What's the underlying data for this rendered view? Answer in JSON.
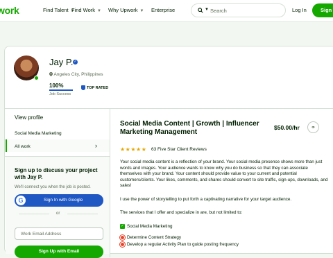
{
  "nav": {
    "logo": "work",
    "links": [
      "Find Talent",
      "Find Work",
      "Why Upwork",
      "Enterprise"
    ],
    "search_placeholder": "Search",
    "login": "Log In",
    "signup": "Sign"
  },
  "profile": {
    "name": "Jay P.",
    "location": "Angeles City, Philippines",
    "jss_value": "100%",
    "jss_fraction": 1.0,
    "jss_label": "Job Success",
    "badge": "TOP RATED"
  },
  "sidebar": {
    "view_profile": "View profile",
    "items": [
      "Social Media Marketing",
      "All work"
    ],
    "cta_title": "Sign up to discuss your project with Jay P.",
    "cta_sub": "We'll connect you when the job is posted.",
    "google_label": "Sign In with Google",
    "or": "or",
    "email_placeholder": "Work Email Address",
    "email_button": "Sign Up with Email"
  },
  "gig": {
    "title": "Social Media Content | Growth | Influencer Marketing Management",
    "price": "$50.00/hr",
    "rating_stars": 5,
    "reviews": "63 Five Star Client Reviews",
    "para1": "Your social media content is a reflection of your brand. Your social media presence shows more than just words and images. Your audience wants to know why you do business so that they can associate themselves with your brand. Your content should provide value to your current and potential customers/clients. Your likes, comments, and shares should convert to site traffic, sign-ups, downloads, and sales!",
    "para2": "I use the power of storytelling to put forth a captivating narrative for your target audience.",
    "para3": "The services that I offer and specialize in are, but not limited to:",
    "checked_service": "Social Media Marketing",
    "sub_services": [
      "Determine Content Strategy",
      "Develop a regular Activity Plan to guide posting frequency"
    ]
  },
  "colors": {
    "brand": "#14a800",
    "link": "#1f57c3"
  }
}
